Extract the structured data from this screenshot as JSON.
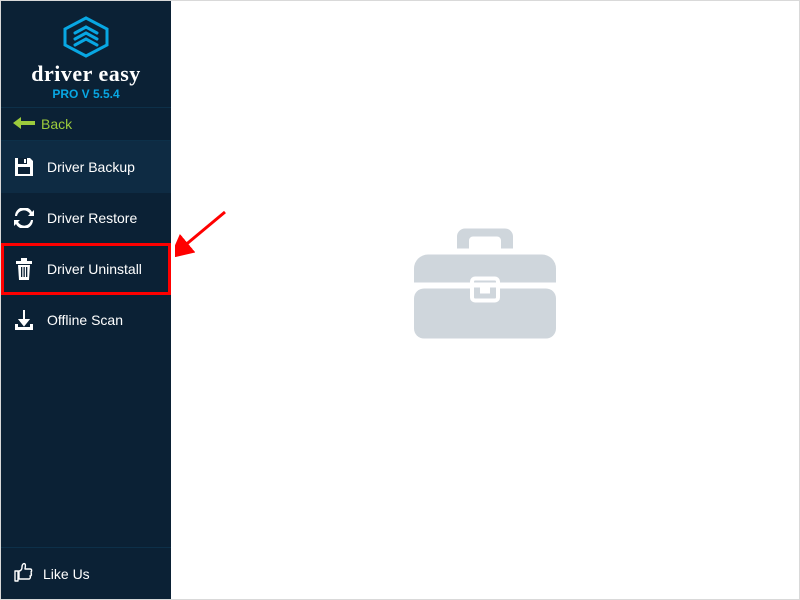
{
  "brand": {
    "name": "driver easy",
    "version": "PRO V 5.5.4"
  },
  "back_label": "Back",
  "nav": {
    "backup": {
      "label": "Driver Backup"
    },
    "restore": {
      "label": "Driver Restore"
    },
    "uninstall": {
      "label": "Driver Uninstall"
    },
    "offline": {
      "label": "Offline Scan"
    }
  },
  "like_us_label": "Like Us",
  "window": {
    "minimize": "—",
    "close": "✕"
  }
}
